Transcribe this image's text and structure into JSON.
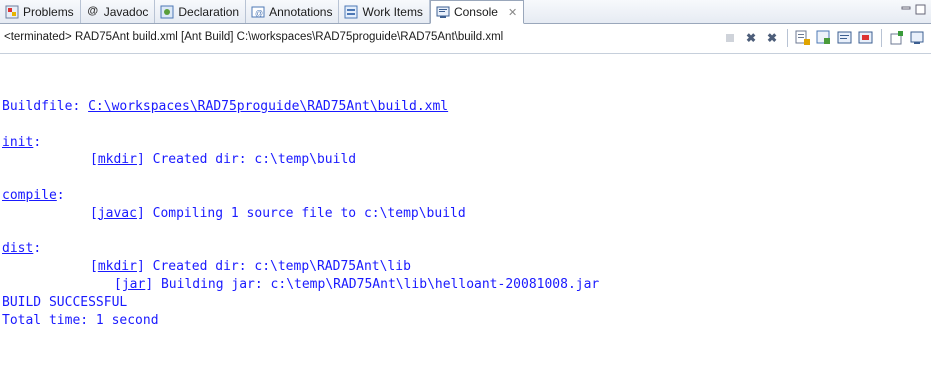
{
  "tabs": [
    {
      "label": "Problems",
      "icon": "problems-icon"
    },
    {
      "label": "Javadoc",
      "icon": "javadoc-icon"
    },
    {
      "label": "Declaration",
      "icon": "declaration-icon"
    },
    {
      "label": "Annotations",
      "icon": "annotations-icon"
    },
    {
      "label": "Work Items",
      "icon": "work-items-icon"
    },
    {
      "label": "Console",
      "icon": "console-icon",
      "active": true
    }
  ],
  "status": "<terminated> RAD75Ant build.xml [Ant Build] C:\\workspaces\\RAD75proguide\\RAD75Ant\\build.xml",
  "console": {
    "buildfile_prefix": "Buildfile: ",
    "buildfile_path": "C:\\workspaces\\RAD75proguide\\RAD75Ant\\build.xml",
    "init_target": "init",
    "init_mkdir_task": "mkdir",
    "init_mkdir_msg": " Created dir: c:\\temp\\build",
    "compile_target": "compile",
    "compile_javac_task": "javac",
    "compile_javac_msg": " Compiling 1 source file to c:\\temp\\build",
    "dist_target": "dist",
    "dist_mkdir_task": "mkdir",
    "dist_mkdir_msg": " Created dir: c:\\temp\\RAD75Ant\\lib",
    "dist_jar_task": "jar",
    "dist_jar_msg": " Building jar: c:\\temp\\RAD75Ant\\lib\\helloant-20081008.jar",
    "result": "BUILD SUCCESSFUL",
    "total_time": "Total time: 1 second"
  }
}
